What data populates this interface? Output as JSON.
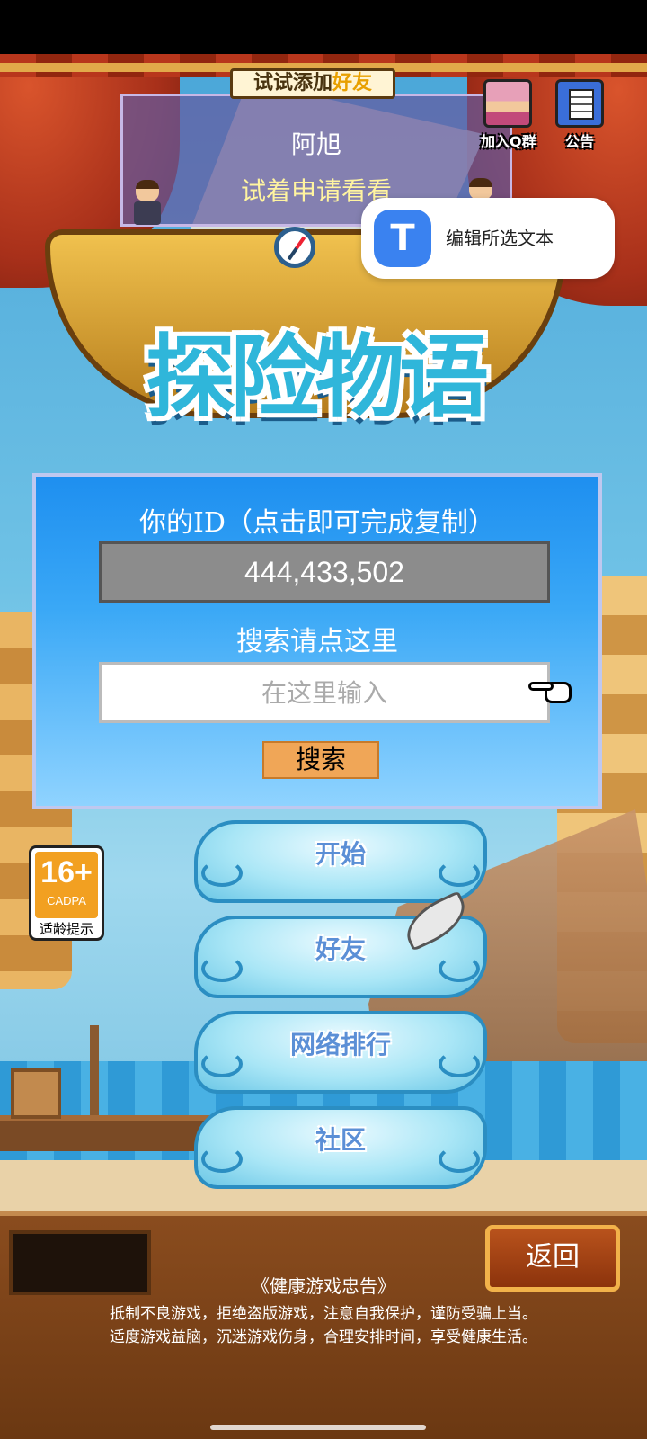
{
  "notice": {
    "banner_prefix": "试试添加",
    "banner_highlight": "好友",
    "name": "阿旭",
    "message": "试着申请看看"
  },
  "top_buttons": {
    "qgroup_label": "加入Q群",
    "announce_label": "公告"
  },
  "edit_popup": {
    "icon_glyph": "T",
    "label": "编辑所选文本"
  },
  "logo": {
    "title": "探险物语"
  },
  "id_panel": {
    "title": "你的ID（点击即可完成复制）",
    "id_value": "444,433,502",
    "search_title": "搜索请点这里",
    "search_placeholder": "在这里输入",
    "search_button": "搜索"
  },
  "menu": {
    "start": "开始",
    "friends": "好友",
    "ranking": "网络排行",
    "community": "社区"
  },
  "age_rating": {
    "age": "16+",
    "org": "CADPA",
    "tip": "适龄提示"
  },
  "bottom": {
    "back": "返回",
    "health_title": "《健康游戏忠告》",
    "health_line_1": "抵制不良游戏，拒绝盗版游戏，注意自我保护，谨防受骗上当。",
    "health_line_2": "适度游戏益脑，沉迷游戏伤身，合理安排时间，享受健康生活。"
  }
}
